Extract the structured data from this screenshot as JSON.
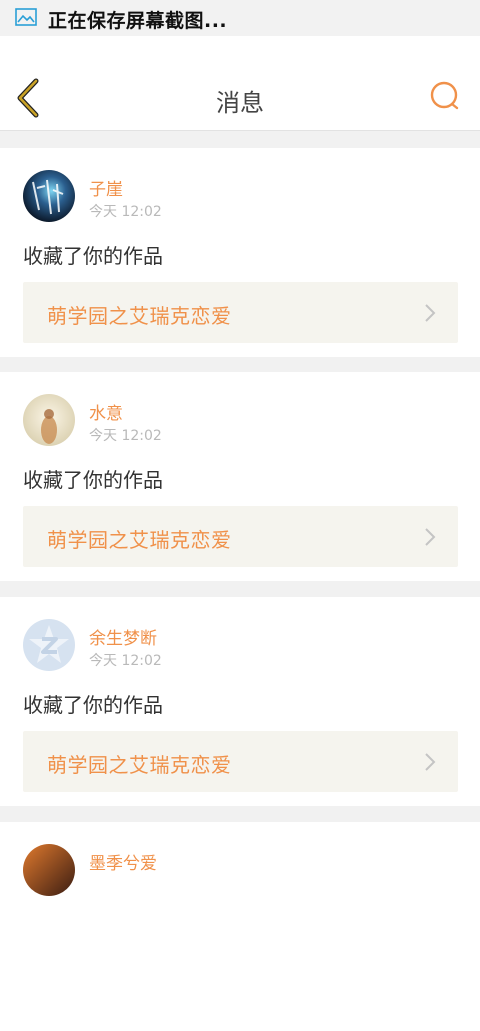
{
  "status_bar": {
    "text": "正在保存屏幕截图...",
    "icon": "gallery-icon"
  },
  "nav": {
    "title": "消息",
    "back_icon": "chevron-left-icon",
    "search_icon": "search-icon"
  },
  "colors": {
    "accent": "#f0914a",
    "back_arrow": "#c9a227",
    "card_bg": "#ffffff",
    "link_bg": "#f5f4ee"
  },
  "messages": [
    {
      "user": "子崖",
      "time": "今天 12:02",
      "action": "收藏了你的作品",
      "work": "萌学园之艾瑞克恋爱"
    },
    {
      "user": "水意",
      "time": "今天 12:02",
      "action": "收藏了你的作品",
      "work": "萌学园之艾瑞克恋爱"
    },
    {
      "user": "余生梦断",
      "time": "今天 12:02",
      "action": "收藏了你的作品",
      "work": "萌学园之艾瑞克恋爱"
    },
    {
      "user": "墨季兮爱",
      "time": "",
      "action": "",
      "work": ""
    }
  ]
}
